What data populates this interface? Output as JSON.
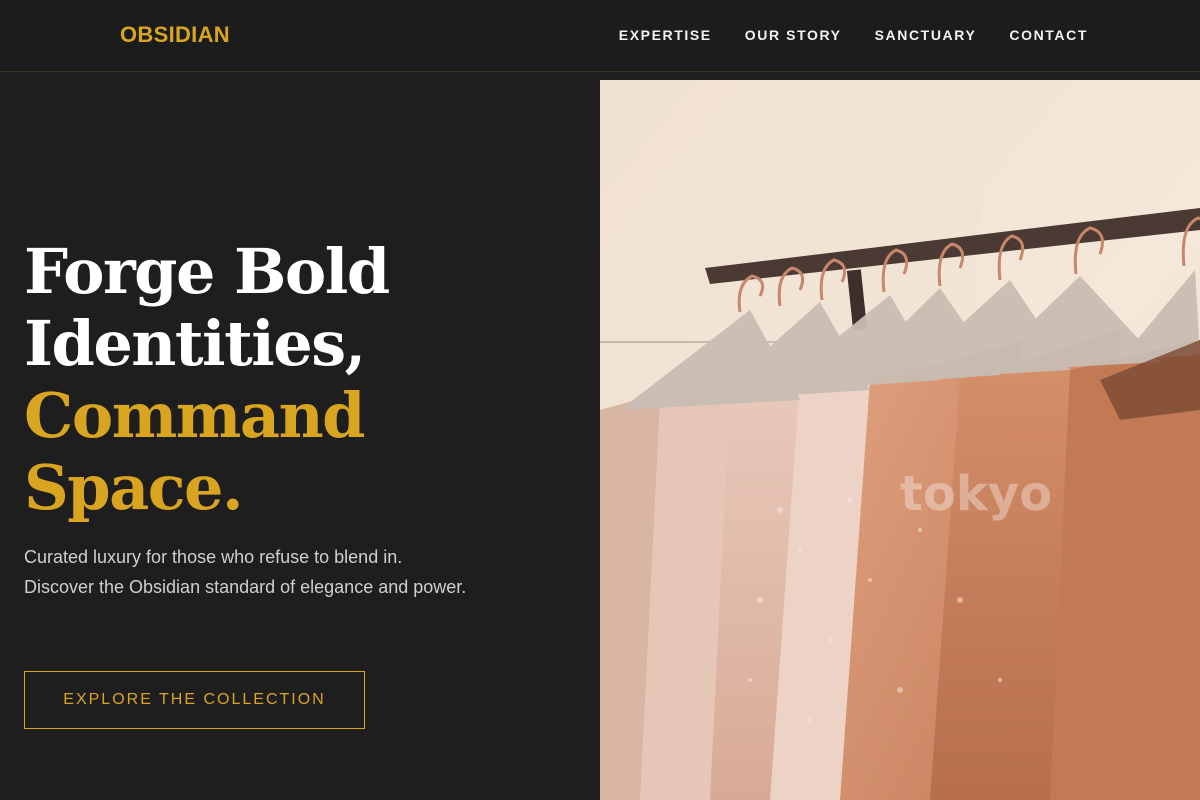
{
  "nav": {
    "logo": "OBSIDIAN",
    "links": [
      "EXPERTISE",
      "OUR STORY",
      "SANCTUARY",
      "CONTACT"
    ]
  },
  "hero": {
    "headline_line1": "Forge Bold",
    "headline_line2": "Identities,",
    "headline_line3": "Command",
    "headline_line4": "Space.",
    "subtext": "Curated luxury for those who refuse to blend in. Discover the Obsidian standard of elegance and power.",
    "cta_label": "EXPLORE THE COLLECTION",
    "image_watermark": "tokyo"
  },
  "colors": {
    "background": "#1e1e1e",
    "accent_gold": "#d9a520",
    "text_white": "#ffffff",
    "text_muted": "#cfcfcf"
  }
}
